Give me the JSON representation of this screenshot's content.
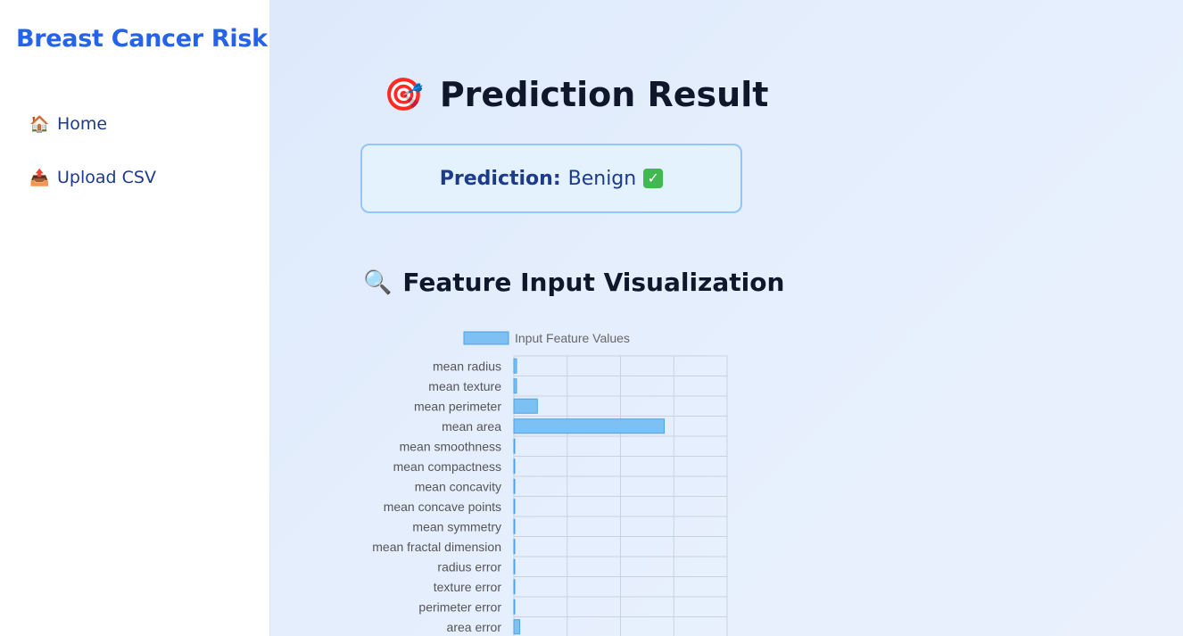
{
  "sidebar": {
    "brand": "Breast Cancer Risk",
    "items": [
      {
        "icon": "house-icon",
        "glyph": "🏠",
        "label": "Home"
      },
      {
        "icon": "upload-tray-icon",
        "glyph": "📤",
        "label": "Upload CSV"
      }
    ]
  },
  "main": {
    "title_icon": "🎯",
    "title": "Prediction Result",
    "prediction": {
      "label": "Prediction:",
      "value": "Benign",
      "check": "✓"
    },
    "section_icon": "🔍",
    "section_title": "Feature Input Visualization"
  },
  "colors": {
    "brand": "#2563eb",
    "bar_fill": "#7cc0f4",
    "bar_stroke": "#4aa3e8"
  },
  "chart_data": {
    "type": "bar",
    "orientation": "horizontal",
    "legend": "Input Feature Values",
    "legend_position": "top",
    "grid": true,
    "xlim": [
      0,
      2000
    ],
    "categories": [
      "mean radius",
      "mean texture",
      "mean perimeter",
      "mean area",
      "mean smoothness",
      "mean compactness",
      "mean concavity",
      "mean concave points",
      "mean symmetry",
      "mean fractal dimension",
      "radius error",
      "texture error",
      "perimeter error",
      "area error"
    ],
    "values": [
      25,
      25,
      220,
      1410,
      0.1,
      0.2,
      0.2,
      0.1,
      0.2,
      0.06,
      1,
      1,
      8,
      55
    ]
  }
}
